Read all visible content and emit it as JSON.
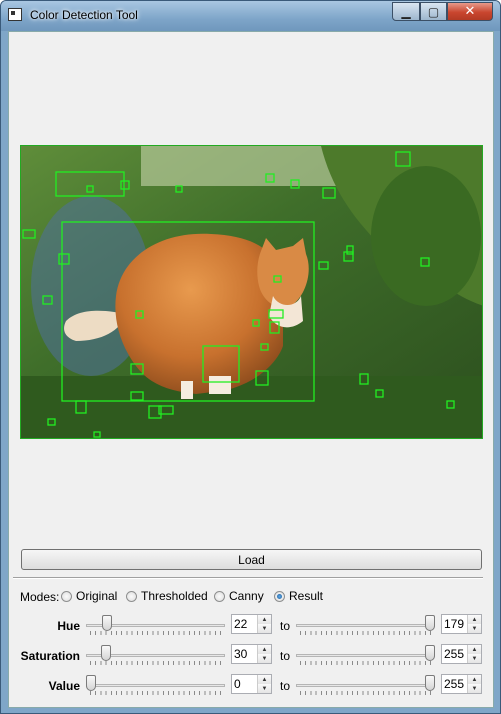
{
  "window": {
    "title": "Color Detection Tool"
  },
  "titlebar_controls": {
    "minimize": "▁",
    "maximize": "▢",
    "close": "✕"
  },
  "actions": {
    "load_label": "Load"
  },
  "modes": {
    "label": "Modes:",
    "options": [
      "Original",
      "Thresholded",
      "Canny",
      "Result"
    ],
    "selected": "Result"
  },
  "ranges": {
    "to_label": "to",
    "hue": {
      "label": "Hue",
      "min_value": "22",
      "max_value": "179",
      "slider_max": 179
    },
    "saturation": {
      "label": "Saturation",
      "min_value": "30",
      "max_value": "255",
      "slider_max": 255
    },
    "value": {
      "label": "Value",
      "min_value": "0",
      "max_value": "255",
      "slider_max": 255
    }
  },
  "colors": {
    "detection_box": "#22ee22",
    "accent": "#2f7bd0"
  }
}
